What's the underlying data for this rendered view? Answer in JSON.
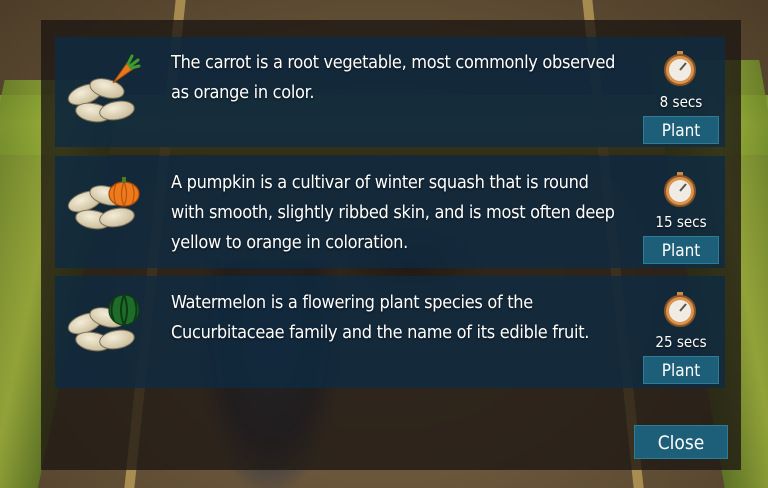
{
  "dialog": {
    "close_label": "Close"
  },
  "crops": [
    {
      "name_icon": "carrot-icon",
      "description": "The carrot is a root vegetable, most commonly observed as orange in color.",
      "time": "8 secs",
      "plant_label": "Plant"
    },
    {
      "name_icon": "pumpkin-icon",
      "description": "A pumpkin is a cultivar of winter squash that is round with smooth, slightly ribbed skin, and is most often deep yellow to orange in coloration.",
      "time": "15 secs",
      "plant_label": "Plant"
    },
    {
      "name_icon": "watermelon-icon",
      "description": "Watermelon is a flowering plant species of the Cucurbitaceae family and the name of its edible fruit.",
      "time": "25 secs",
      "plant_label": "Plant"
    }
  ],
  "colors": {
    "row_bg": "#0e2a42",
    "button_bg": "#1d5f78"
  }
}
